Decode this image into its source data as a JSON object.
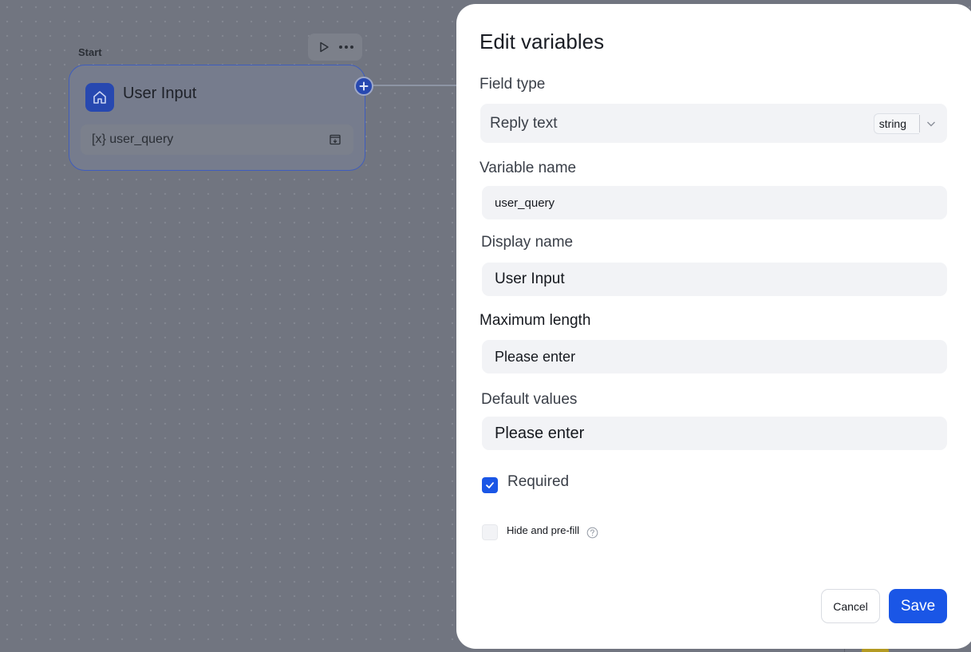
{
  "canvas": {
    "node": {
      "label": "Start",
      "title": "User Input",
      "variable": "[x} user_query",
      "icons": [
        "play-icon",
        "more-icon",
        "home-icon",
        "expand-icon",
        "plus-icon"
      ]
    }
  },
  "modal": {
    "title": "Edit variables",
    "field_type": {
      "label": "Field type",
      "value": "Reply text",
      "type": "string"
    },
    "variable_name": {
      "label": "Variable name",
      "value": "user_query"
    },
    "display_name": {
      "label": "Display name",
      "value": "User Input"
    },
    "max_length": {
      "label": "Maximum length",
      "placeholder": "Please enter"
    },
    "default_values": {
      "label": "Default values",
      "placeholder": "Please enter"
    },
    "required": {
      "label": "Required",
      "checked": true
    },
    "hide_prefill": {
      "label": "Hide and pre-fill",
      "checked": false
    },
    "buttons": {
      "cancel": "Cancel",
      "save": "Save"
    }
  },
  "colors": {
    "accent": "#1a56e6",
    "node_icon_bg": "#2748b0",
    "overlay": "#717580"
  }
}
